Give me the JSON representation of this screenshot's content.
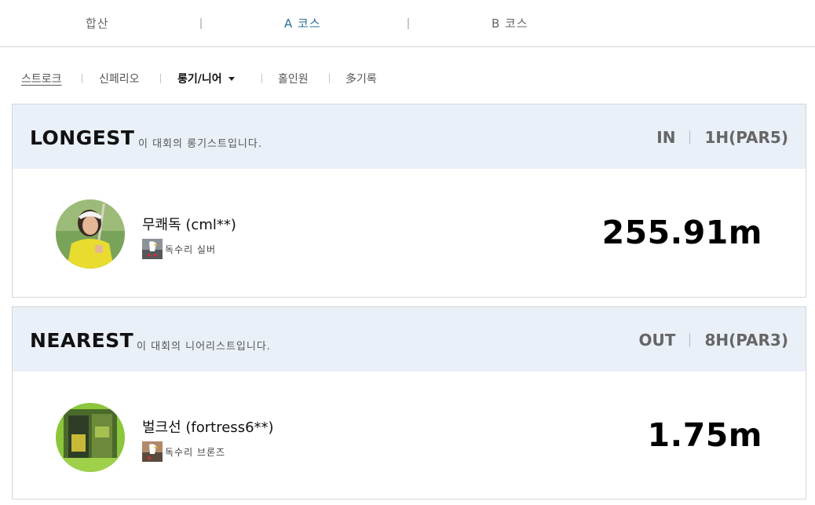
{
  "course_tabs": [
    {
      "label": "합산"
    },
    {
      "label": "A 코스"
    },
    {
      "label": "B 코스"
    }
  ],
  "sub_tabs": {
    "stroke": "스트로크",
    "callaway": "신페리오",
    "longest_nearest": "롱기/니어",
    "hole_in_one": "홀인원",
    "multi_record": "多기록"
  },
  "longest": {
    "title": "LONGEST",
    "description": "이 대회의 롱기스트입니다.",
    "course": "IN",
    "hole": "1H(PAR5)",
    "player_name": "무쾌독 (cml**)",
    "badge_label": "독수리 실버",
    "record": "255.91m"
  },
  "nearest": {
    "title": "NEAREST",
    "description": "이 대회의 니어리스트입니다.",
    "course": "OUT",
    "hole": "8H(PAR3)",
    "player_name": "벌크선 (fortress6**)",
    "badge_label": "독수리 브론즈",
    "record": "1.75m"
  },
  "colors": {
    "active_tab": "#2a6f9e",
    "panel_header_bg": "#e9f0f8",
    "record_text": "#000000"
  },
  "icons": {
    "sub_tab_dropdown": "caret-down-icon",
    "badge": "eagle-icon"
  }
}
